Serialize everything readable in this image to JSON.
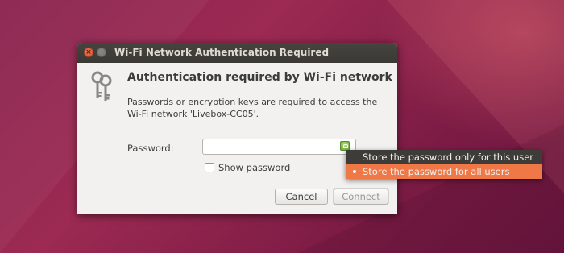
{
  "window": {
    "title": "Wi-Fi Network Authentication Required",
    "close_glyph": "×",
    "minimize_glyph": "–"
  },
  "dialog": {
    "icon": "keys-icon",
    "heading": "Authentication required by Wi-Fi network",
    "description": "Passwords or encryption keys are required to access the Wi-Fi network 'Livebox-CC05'.",
    "password_label": "Password:",
    "password_value": "",
    "show_password_label": "Show password",
    "show_password_checked": false,
    "cancel_label": "Cancel",
    "connect_label": "Connect"
  },
  "store_menu": {
    "items": [
      {
        "label": "Store the password only for this user",
        "selected": false
      },
      {
        "label": "Store the password for all users",
        "selected": true
      }
    ]
  },
  "colors": {
    "accent": "#f07746",
    "titlebar": "#3a3935",
    "dialog_bg": "#f2f1f0",
    "desktop": "#8a2450"
  }
}
